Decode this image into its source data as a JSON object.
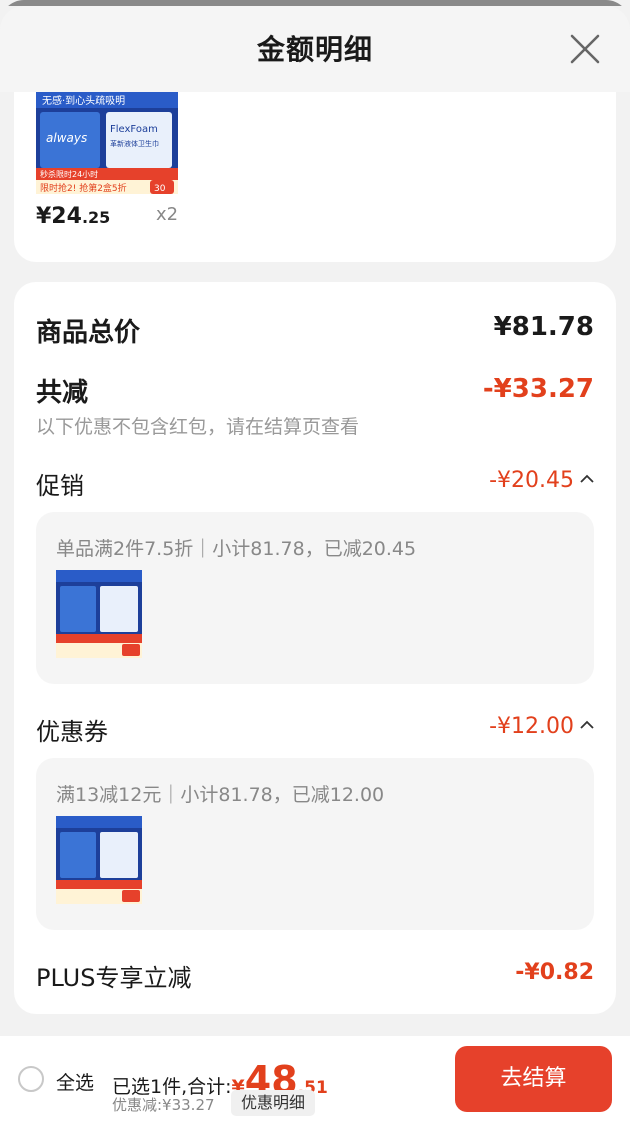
{
  "header": {
    "title": "金额明细"
  },
  "product": {
    "price_int": "¥24",
    "price_dec": ".25",
    "quantity": "x2",
    "thumb_text": {
      "banner": "无感·到心头疏吸明",
      "brand": "always",
      "feature": "FlexFoam",
      "feature_sub": "革新液体卫生巾",
      "badge": "30",
      "promo_top": "秒杀限时24小时",
      "promo_bottom": "限时抢2! 抢第2盒5折"
    }
  },
  "summary": {
    "goods_total_label": "商品总价",
    "goods_total_value": "¥81.78",
    "reduction_label": "共减",
    "reduction_value": "-¥33.27",
    "note": "以下优惠不包含红包，请在结算页查看"
  },
  "promotion": {
    "label": "促销",
    "value": "-¥20.45",
    "detail": "单品满2件7.5折｜小计81.78，已减20.45"
  },
  "coupon": {
    "label": "优惠券",
    "value": "-¥12.00",
    "detail": "满13减12元｜小计81.78，已减12.00"
  },
  "plus": {
    "label": "PLUS专享立减",
    "value": "-¥0.82"
  },
  "bottom_bar": {
    "select_all": "全选",
    "selected_text": "已选1件,合计:",
    "total_yen": "¥",
    "total_int": "48",
    "total_dec": ".51",
    "discount_text": "优惠减:¥33.27",
    "detail_link": "优惠明细",
    "checkout": "去结算"
  },
  "colors": {
    "accent": "#e2401c",
    "button": "#e6412b",
    "sheet_bg": "#f2f2f2"
  },
  "icons": [
    "close-icon",
    "chevron-up-icon",
    "radio-unchecked-icon"
  ]
}
